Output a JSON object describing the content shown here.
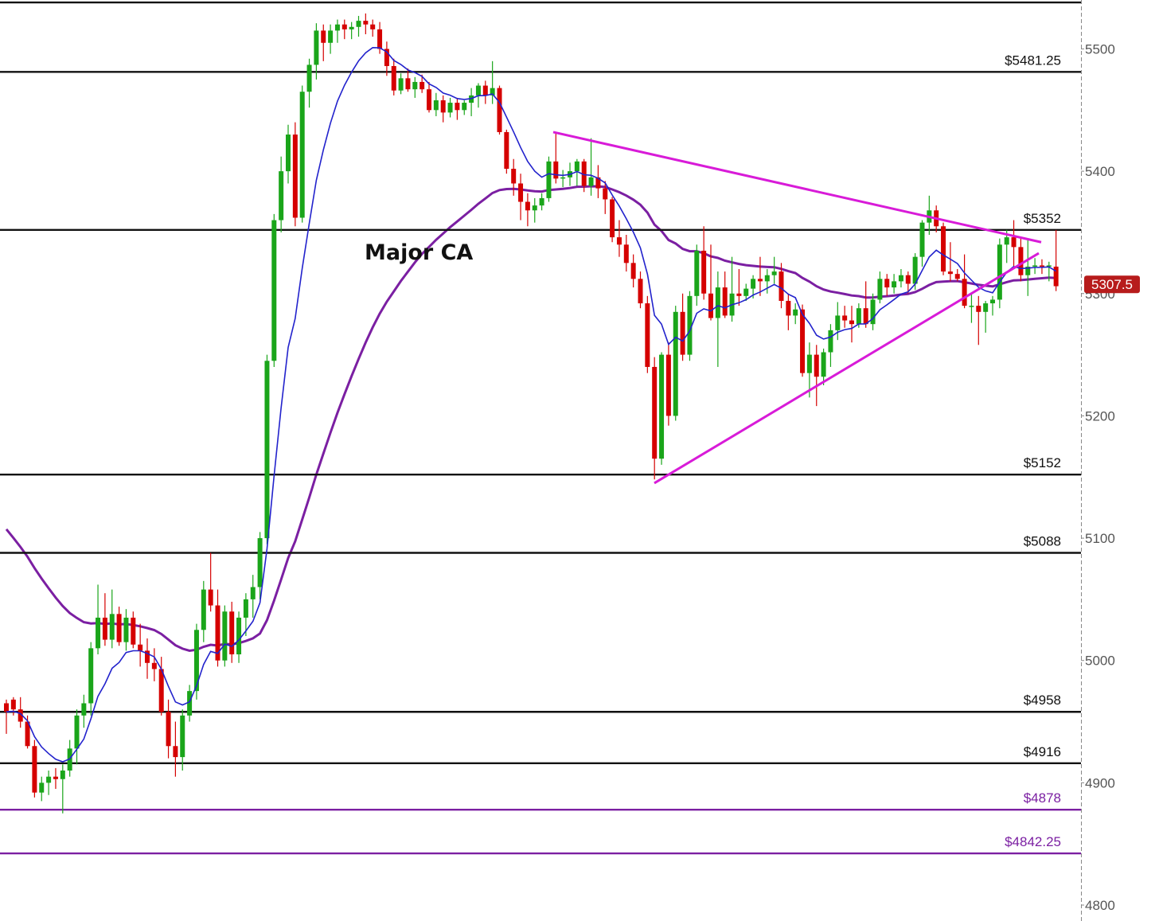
{
  "chart_data": {
    "type": "candlestick",
    "y_axis": {
      "ticks": [
        4800,
        4900,
        5000,
        5100,
        5200,
        5300,
        5400,
        5500
      ],
      "range": [
        4793,
        5540
      ]
    },
    "current_price": {
      "label": "5307.5",
      "value": 5307.5,
      "color": "#b71c1c"
    },
    "levels": [
      {
        "value": 5538,
        "label": "",
        "color": "#111111"
      },
      {
        "value": 5481.25,
        "label": "$5481.25",
        "color": "#111111"
      },
      {
        "value": 5352,
        "label": "$5352",
        "color": "#111111"
      },
      {
        "value": 5152,
        "label": "$5152",
        "color": "#111111"
      },
      {
        "value": 5088,
        "label": "$5088",
        "color": "#111111"
      },
      {
        "value": 4958,
        "label": "$4958",
        "color": "#111111"
      },
      {
        "value": 4916,
        "label": "$4916",
        "color": "#111111"
      },
      {
        "value": 4878,
        "label": "$4878",
        "color": "#7b1fa2"
      },
      {
        "value": 4842.25,
        "label": "$4842.25",
        "color": "#7b1fa2"
      }
    ],
    "annotation": "Major CA",
    "colors": {
      "up": "#1aa51a",
      "down": "#d50000",
      "wick": "#333333",
      "fast_ma": "#2222cc",
      "slow_ma": "#7b1fa2",
      "trendline": "#d81bd8"
    },
    "trendlines": [
      {
        "name": "upper",
        "start": [
          695,
          5432
        ],
        "end": [
          1308,
          5342
        ]
      },
      {
        "name": "lower",
        "start": [
          822,
          5145
        ],
        "end": [
          1305,
          5333
        ]
      }
    ],
    "candles": [
      [
        4965,
        4968,
        4940,
        4958
      ],
      [
        4968,
        4970,
        4955,
        4960
      ],
      [
        4960,
        4970,
        4945,
        4950
      ],
      [
        4950,
        4955,
        4928,
        4930
      ],
      [
        4930,
        4935,
        4888,
        4892
      ],
      [
        4892,
        4905,
        4885,
        4900
      ],
      [
        4900,
        4910,
        4890,
        4905
      ],
      [
        4905,
        4912,
        4895,
        4903
      ],
      [
        4903,
        4915,
        4875,
        4910
      ],
      [
        4910,
        4935,
        4905,
        4928
      ],
      [
        4928,
        4960,
        4915,
        4955
      ],
      [
        4955,
        4972,
        4945,
        4965
      ],
      [
        4965,
        5015,
        4955,
        5010
      ],
      [
        5010,
        5062,
        5005,
        5035
      ],
      [
        5035,
        5055,
        5012,
        5017
      ],
      [
        5017,
        5058,
        5010,
        5038
      ],
      [
        5038,
        5044,
        5012,
        5015
      ],
      [
        5015,
        5042,
        5008,
        5035
      ],
      [
        5035,
        5040,
        5010,
        5013
      ],
      [
        5013,
        5030,
        4995,
        5008
      ],
      [
        5008,
        5018,
        4985,
        4998
      ],
      [
        4998,
        5010,
        4983,
        4993
      ],
      [
        4993,
        5003,
        4955,
        4958
      ],
      [
        4958,
        4968,
        4920,
        4930
      ],
      [
        4930,
        4950,
        4905,
        4921
      ],
      [
        4921,
        4960,
        4910,
        4955
      ],
      [
        4955,
        4980,
        4950,
        4975
      ],
      [
        4975,
        5030,
        4968,
        5025
      ],
      [
        5025,
        5065,
        5015,
        5058
      ],
      [
        5058,
        5088,
        5040,
        5045
      ],
      [
        5045,
        5058,
        4995,
        5000
      ],
      [
        5000,
        5045,
        4995,
        5040
      ],
      [
        5040,
        5048,
        4998,
        5005
      ],
      [
        5005,
        5040,
        4998,
        5035
      ],
      [
        5035,
        5055,
        5020,
        5050
      ],
      [
        5050,
        5070,
        5035,
        5060
      ],
      [
        5060,
        5105,
        5050,
        5100
      ],
      [
        5100,
        5250,
        5095,
        5245
      ],
      [
        5245,
        5365,
        5240,
        5360
      ],
      [
        5360,
        5412,
        5350,
        5400
      ],
      [
        5400,
        5438,
        5390,
        5430
      ],
      [
        5430,
        5440,
        5355,
        5362
      ],
      [
        5362,
        5470,
        5358,
        5465
      ],
      [
        5465,
        5492,
        5452,
        5487
      ],
      [
        5487,
        5521,
        5475,
        5515
      ],
      [
        5515,
        5520,
        5490,
        5505
      ],
      [
        5505,
        5520,
        5496,
        5515
      ],
      [
        5515,
        5524,
        5505,
        5520
      ],
      [
        5520,
        5524,
        5508,
        5516
      ],
      [
        5516,
        5522,
        5508,
        5518
      ],
      [
        5518,
        5527,
        5510,
        5523
      ],
      [
        5523,
        5529,
        5512,
        5520
      ],
      [
        5520,
        5524,
        5510,
        5516
      ],
      [
        5516,
        5522,
        5496,
        5500
      ],
      [
        5500,
        5506,
        5478,
        5486
      ],
      [
        5486,
        5492,
        5462,
        5466
      ],
      [
        5466,
        5480,
        5463,
        5476
      ],
      [
        5476,
        5484,
        5465,
        5467
      ],
      [
        5467,
        5477,
        5460,
        5473
      ],
      [
        5473,
        5479,
        5464,
        5467
      ],
      [
        5467,
        5473,
        5448,
        5450
      ],
      [
        5450,
        5464,
        5445,
        5458
      ],
      [
        5458,
        5462,
        5440,
        5448
      ],
      [
        5448,
        5460,
        5444,
        5456
      ],
      [
        5456,
        5460,
        5442,
        5450
      ],
      [
        5450,
        5458,
        5446,
        5456
      ],
      [
        5456,
        5468,
        5445,
        5462
      ],
      [
        5462,
        5472,
        5452,
        5470
      ],
      [
        5470,
        5474,
        5455,
        5462
      ],
      [
        5462,
        5490,
        5455,
        5468
      ],
      [
        5468,
        5470,
        5430,
        5432
      ],
      [
        5432,
        5434,
        5398,
        5402
      ],
      [
        5402,
        5410,
        5380,
        5390
      ],
      [
        5390,
        5398,
        5360,
        5375
      ],
      [
        5375,
        5382,
        5355,
        5368
      ],
      [
        5368,
        5378,
        5358,
        5372
      ],
      [
        5372,
        5382,
        5368,
        5378
      ],
      [
        5378,
        5412,
        5375,
        5408
      ],
      [
        5408,
        5432,
        5390,
        5394
      ],
      [
        5394,
        5401,
        5387,
        5395
      ],
      [
        5395,
        5407,
        5388,
        5400
      ],
      [
        5400,
        5410,
        5388,
        5408
      ],
      [
        5408,
        5410,
        5383,
        5388
      ],
      [
        5388,
        5427,
        5380,
        5395
      ],
      [
        5395,
        5405,
        5378,
        5386
      ],
      [
        5386,
        5392,
        5365,
        5377
      ],
      [
        5377,
        5379,
        5342,
        5346
      ],
      [
        5346,
        5360,
        5330,
        5340
      ],
      [
        5340,
        5348,
        5318,
        5325
      ],
      [
        5325,
        5332,
        5305,
        5312
      ],
      [
        5312,
        5318,
        5288,
        5292
      ],
      [
        5292,
        5298,
        5235,
        5240
      ],
      [
        5240,
        5248,
        5148,
        5165
      ],
      [
        5165,
        5252,
        5160,
        5250
      ],
      [
        5250,
        5260,
        5192,
        5200
      ],
      [
        5200,
        5290,
        5196,
        5285
      ],
      [
        5285,
        5300,
        5245,
        5250
      ],
      [
        5250,
        5302,
        5245,
        5298
      ],
      [
        5298,
        5340,
        5290,
        5335
      ],
      [
        5335,
        5355,
        5295,
        5300
      ],
      [
        5300,
        5340,
        5278,
        5280
      ],
      [
        5280,
        5318,
        5240,
        5305
      ],
      [
        5305,
        5318,
        5280,
        5282
      ],
      [
        5282,
        5330,
        5277,
        5300
      ],
      [
        5300,
        5320,
        5290,
        5298
      ],
      [
        5298,
        5308,
        5294,
        5304
      ],
      [
        5304,
        5315,
        5296,
        5312
      ],
      [
        5312,
        5330,
        5298,
        5310
      ],
      [
        5310,
        5320,
        5300,
        5315
      ],
      [
        5315,
        5330,
        5308,
        5318
      ],
      [
        5318,
        5325,
        5288,
        5294
      ],
      [
        5294,
        5300,
        5270,
        5282
      ],
      [
        5282,
        5292,
        5275,
        5287
      ],
      [
        5287,
        5291,
        5232,
        5235
      ],
      [
        5235,
        5260,
        5215,
        5250
      ],
      [
        5250,
        5258,
        5208,
        5232
      ],
      [
        5232,
        5255,
        5225,
        5252
      ],
      [
        5252,
        5275,
        5240,
        5270
      ],
      [
        5270,
        5293,
        5262,
        5282
      ],
      [
        5282,
        5290,
        5272,
        5278
      ],
      [
        5278,
        5290,
        5260,
        5275
      ],
      [
        5275,
        5292,
        5272,
        5288
      ],
      [
        5288,
        5310,
        5272,
        5275
      ],
      [
        5275,
        5300,
        5270,
        5295
      ],
      [
        5295,
        5318,
        5292,
        5312
      ],
      [
        5312,
        5316,
        5298,
        5305
      ],
      [
        5305,
        5316,
        5300,
        5310
      ],
      [
        5310,
        5320,
        5305,
        5315
      ],
      [
        5315,
        5318,
        5300,
        5308
      ],
      [
        5308,
        5333,
        5303,
        5330
      ],
      [
        5330,
        5360,
        5322,
        5358
      ],
      [
        5358,
        5380,
        5348,
        5368
      ],
      [
        5368,
        5372,
        5350,
        5355
      ],
      [
        5355,
        5358,
        5315,
        5318
      ],
      [
        5318,
        5342,
        5310,
        5316
      ],
      [
        5316,
        5320,
        5310,
        5312
      ],
      [
        5312,
        5332,
        5288,
        5290
      ],
      [
        5290,
        5300,
        5276,
        5290
      ],
      [
        5290,
        5298,
        5258,
        5285
      ],
      [
        5285,
        5294,
        5268,
        5292
      ],
      [
        5292,
        5298,
        5282,
        5295
      ],
      [
        5295,
        5345,
        5288,
        5340
      ],
      [
        5340,
        5352,
        5325,
        5346
      ],
      [
        5346,
        5360,
        5320,
        5338
      ],
      [
        5338,
        5346,
        5310,
        5315
      ],
      [
        5315,
        5345,
        5298,
        5322
      ],
      [
        5322,
        5329,
        5316,
        5323
      ],
      [
        5323,
        5328,
        5316,
        5322
      ],
      [
        5322,
        5326,
        5310,
        5323
      ],
      [
        5322,
        5352,
        5302,
        5306
      ]
    ]
  }
}
